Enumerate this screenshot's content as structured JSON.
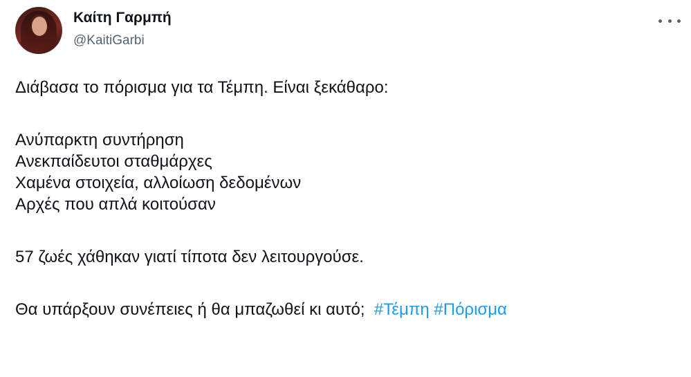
{
  "author": {
    "display_name": "Καίτη Γαρμπή",
    "handle": "@KaitiGarbi",
    "avatar_icon": "profile-photo"
  },
  "tweet": {
    "intro": "Διάβασα το πόρισμα για τα Τέμπη. Είναι ξεκάθαρο:",
    "list": [
      "Ανύπαρκτη συντήρηση",
      "Ανεκπαίδευτοι σταθμάρχες",
      "Χαμένα στοιχεία, αλλοίωση δεδομένων",
      "Αρχές που απλά κοιτούσαν"
    ],
    "statement": "57 ζωές χάθηκαν γιατί τίποτα δεν λειτουργούσε.",
    "closing": "Θα υπάρξουν συνέπειες ή θα μπαζωθεί κι αυτό;",
    "hashtags": [
      "#Τέμπη",
      "#Πόρισμα"
    ]
  },
  "colors": {
    "text": "#0f1419",
    "secondary": "#536471",
    "link": "#1d9bf0"
  }
}
